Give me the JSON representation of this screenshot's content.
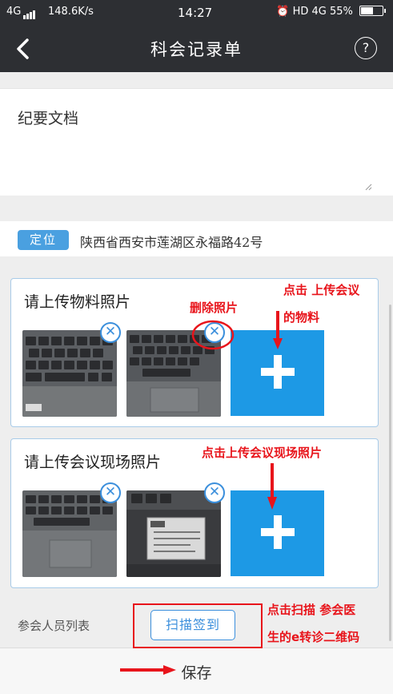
{
  "status_bar": {
    "network": "4G",
    "speed": "148.6K/s",
    "time": "14:27",
    "right": "HD 4G 55%",
    "battery_level": 0.55
  },
  "nav": {
    "title": "科会记录单",
    "help_glyph": "?"
  },
  "summary": {
    "label": "纪要文档"
  },
  "location": {
    "badge": "定位",
    "address": "陕西省西安市莲湖区永福路42号"
  },
  "materials": {
    "title": "请上传物料照片"
  },
  "scene": {
    "title": "请上传会议现场照片"
  },
  "attendees": {
    "label": "参会人员列表",
    "scan_button": "扫描签到"
  },
  "bottom": {
    "save_label": "保存"
  },
  "annotations": {
    "delete_photo": "删除照片",
    "upload_materials_line1": "点击 上传会议",
    "upload_materials_line2": "的物料",
    "upload_scene": "点击上传会议现场照片",
    "scan_line1": "点击扫描 参会医",
    "scan_line2": "生的e转诊二维码"
  },
  "icons": {
    "back": "chevron-left-icon",
    "help": "question-circle-icon",
    "remove": "close-circle-icon",
    "add": "plus-icon"
  },
  "colors": {
    "header": "#2d2f33",
    "accent": "#1d99e5",
    "annotation": "#e8141b"
  }
}
